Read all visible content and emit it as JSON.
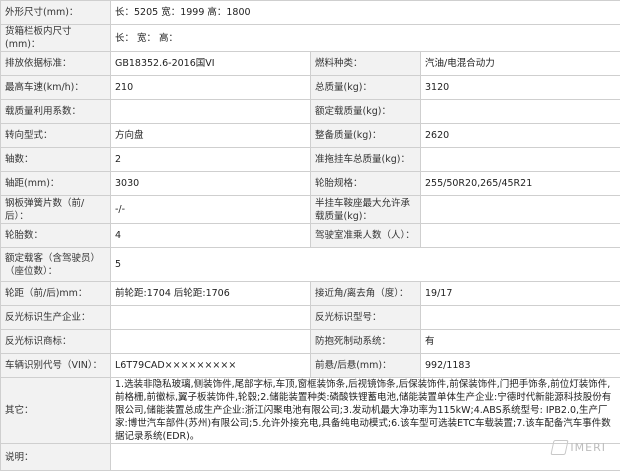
{
  "rows": [
    {
      "l1": "外形尺寸(mm)：",
      "v1": "长：5205 宽：1999 高：1800"
    },
    {
      "l1": "货箱栏板内尺寸(mm)：",
      "v1": "长：  宽：  高："
    },
    {
      "l1": "排放依据标准：",
      "v1": "GB18352.6-2016国VI",
      "l2": "燃料种类：",
      "v2": "汽油/电混合动力"
    },
    {
      "l1": "最高车速(km/h)：",
      "v1": "210",
      "l2": "总质量(kg)：",
      "v2": "3120"
    },
    {
      "l1": "载质量利用系数：",
      "v1": "",
      "l2": "额定载质量(kg)：",
      "v2": ""
    },
    {
      "l1": "转向型式：",
      "v1": "方向盘",
      "l2": "整备质量(kg)：",
      "v2": "2620"
    },
    {
      "l1": "轴数：",
      "v1": "2",
      "l2": "准拖挂车总质量(kg)：",
      "v2": ""
    },
    {
      "l1": "轴距(mm)：",
      "v1": "3030",
      "l2": "轮胎规格：",
      "v2": "255/50R20,265/45R21"
    },
    {
      "l1": "钢板弹簧片数（前/后）：",
      "v1": "-/-",
      "l2": "半挂车鞍座最大允许承载质量(kg)：",
      "v2": ""
    },
    {
      "l1": "轮胎数：",
      "v1": "4",
      "l2": "驾驶室准乘人数（人）：",
      "v2": ""
    },
    {
      "l1": "额定载客（含驾驶员）（座位数）：",
      "v1": "5"
    },
    {
      "l1": "轮距（前/后)mm：",
      "v1": "前轮距:1704 后轮距:1706",
      "l2": "接近角/离去角（度）：",
      "v2": "19/17"
    },
    {
      "l1": "反光标识生产企业：",
      "v1": "",
      "l2": "反光标识型号：",
      "v2": ""
    },
    {
      "l1": "反光标识商标：",
      "v1": "",
      "l2": "防抱死制动系统：",
      "v2": "有"
    },
    {
      "l1": "车辆识别代号（VIN）：",
      "v1": "L6T79CAD×××××××××",
      "l2": "前悬/后悬(mm)：",
      "v2": "992/1183"
    },
    {
      "l1": "其它：",
      "v1": "1.选装非隐私玻璃,侧装饰件,尾部字标,车顶,窗框装饰条,后视镜饰条,后保装饰件,前保装饰件,门把手饰条,前位灯装饰件,前格栅,前徽标,翼子板装饰件,轮毂;2.储能装置种类:磷酸铁锂蓄电池,储能装置单体生产企业:宁德时代新能源科技股份有限公司,储能装置总成生产企业:浙江闪聚电池有限公司;3.发动机最大净功率为115kW;4.ABS系统型号: IPB2.0,生产厂家:博世汽车部件(苏州)有限公司;5.允许外接充电,具备纯电动模式;6.该车型可选装ETC车载装置;7.该车配备汽车事件数据记录系统(EDR)。"
    },
    {
      "l1": "说明：",
      "v1": ""
    }
  ],
  "watermark": "IMERI"
}
